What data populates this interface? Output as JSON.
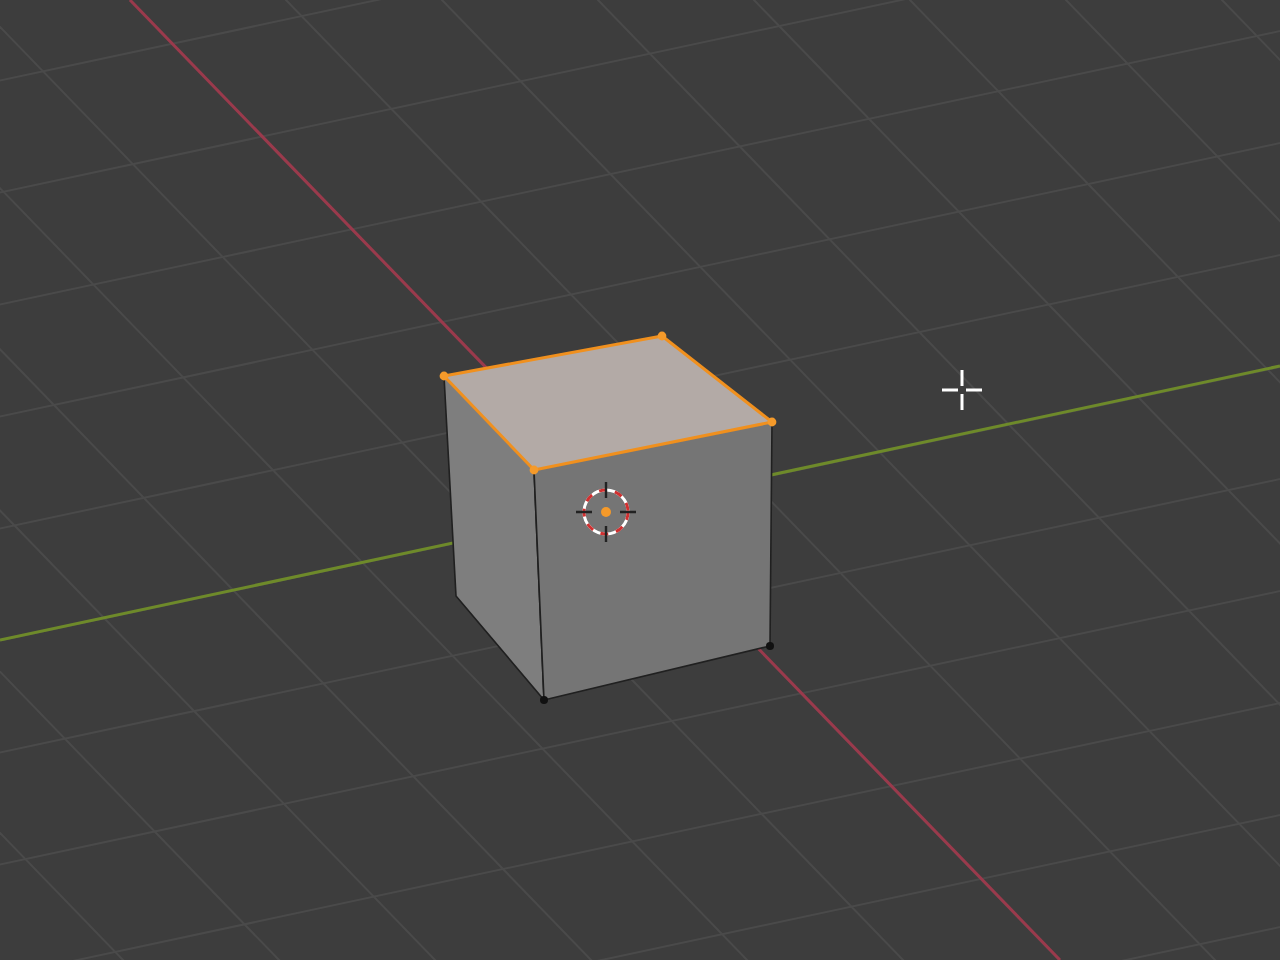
{
  "cube": {
    "faces": [
      {
        "kind": "left",
        "selected": false
      },
      {
        "kind": "front",
        "selected": false
      },
      {
        "kind": "top",
        "selected": true
      }
    ]
  }
}
